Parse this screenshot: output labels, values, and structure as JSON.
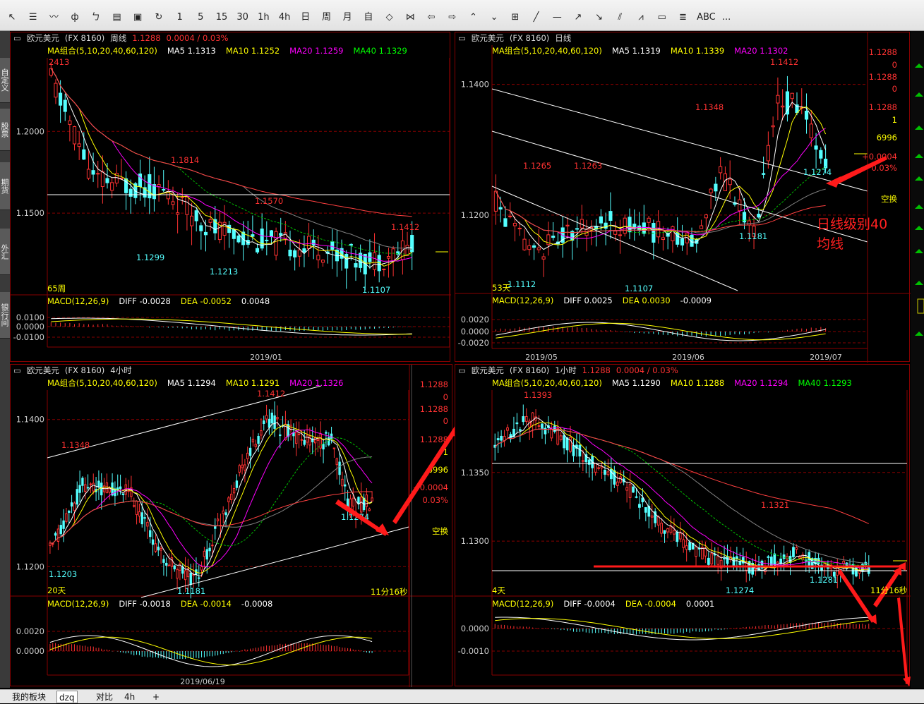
{
  "toolbar": {
    "items": [
      {
        "id": "arrow",
        "icon": "↖",
        "name": "cursor-icon"
      },
      {
        "id": "list",
        "icon": "☰",
        "name": "list-icon"
      },
      {
        "id": "line",
        "icon": "〰",
        "name": "line-chart-icon"
      },
      {
        "id": "kline",
        "icon": "ф",
        "name": "candlestick-icon"
      },
      {
        "id": "fenshi",
        "icon": "ㄅ",
        "name": "timeshare-icon"
      },
      {
        "id": "f10",
        "icon": "▤",
        "name": "f10-icon"
      },
      {
        "id": "save",
        "icon": "▣",
        "name": "save-icon"
      },
      {
        "id": "refresh",
        "icon": "↻",
        "name": "refresh-icon"
      },
      {
        "id": "p1",
        "label": "1"
      },
      {
        "id": "p5",
        "label": "5"
      },
      {
        "id": "p15",
        "label": "15"
      },
      {
        "id": "p30",
        "label": "30"
      },
      {
        "id": "p1h",
        "label": "1h"
      },
      {
        "id": "p4h",
        "label": "4h"
      },
      {
        "id": "day",
        "label": "日"
      },
      {
        "id": "week",
        "label": "周"
      },
      {
        "id": "month",
        "label": "月"
      },
      {
        "id": "custom",
        "label": "自"
      },
      {
        "id": "zoomin",
        "icon": "◇",
        "name": "zoom-in-icon"
      },
      {
        "id": "zoomout",
        "icon": "⋈",
        "name": "zoom-out-icon"
      },
      {
        "id": "left",
        "icon": "⇦",
        "name": "arrow-left-icon"
      },
      {
        "id": "right",
        "icon": "⇨",
        "name": "arrow-right-icon"
      },
      {
        "id": "up",
        "icon": "⌃",
        "name": "arrow-up-icon"
      },
      {
        "id": "down",
        "icon": "⌄",
        "name": "arrow-down-icon"
      },
      {
        "id": "layout",
        "icon": "⊞",
        "name": "layout-icon"
      },
      {
        "id": "draw1",
        "icon": "╱",
        "name": "draw-line-icon"
      },
      {
        "id": "draw2",
        "icon": "—",
        "name": "horizontal-line-icon"
      },
      {
        "id": "draw3",
        "icon": "↗",
        "name": "ray-icon"
      },
      {
        "id": "draw4",
        "icon": "↘",
        "name": "down-ray-icon"
      },
      {
        "id": "draw5",
        "icon": "⫽",
        "name": "parallel-line-icon"
      },
      {
        "id": "draw6",
        "icon": "⩘",
        "name": "wave-icon"
      },
      {
        "id": "draw7",
        "icon": "▭",
        "name": "rect-icon"
      },
      {
        "id": "draw8",
        "icon": "≣",
        "name": "fib-icon"
      },
      {
        "id": "abc",
        "label": "ABC"
      },
      {
        "id": "more",
        "label": "..."
      }
    ]
  },
  "leftbar": {
    "tabs": [
      "自定义",
      "股票",
      "期货",
      "外汇",
      "银行间"
    ]
  },
  "bottombar": {
    "tabs": [
      "我的板块",
      "dzq",
      "对比",
      "4h"
    ],
    "add": "+"
  },
  "panels": [
    {
      "id": "weekly",
      "title": {
        "symbol": "欧元美元",
        "code": "(FX 8160)",
        "period": "周线",
        "price": "1.1288",
        "change": "0.0004 / 0.03%"
      },
      "ma": {
        "label": "MA组合(5,10,20,40,60,120)",
        "ma5": "MA5 1.1313",
        "ma10": "MA10 1.1252",
        "ma20": "MA20 1.1259",
        "ma40": "MA40 1.1329"
      },
      "yticks": [
        "1.2000",
        "1.1500"
      ],
      "labels": [
        "2413",
        "1.1814",
        "1.1570",
        "1.1412",
        "1.1299",
        "1.1213",
        "1.1107",
        "65周"
      ],
      "macd": {
        "label": "MACD(12,26,9)",
        "diff": "DIFF -0.0028",
        "dea": "DEA -0.0052",
        "val": "0.0048"
      },
      "macd_ticks": [
        "0.0100",
        "0.0000",
        "-0.0100"
      ],
      "date": "2019/01"
    },
    {
      "id": "daily",
      "title": {
        "symbol": "欧元美元",
        "code": "(FX 8160)",
        "period": "日线"
      },
      "ma": {
        "label": "MA组合(5,10,20,40,60,120)",
        "ma5": "MA5 1.1319",
        "ma10": "MA10 1.1339",
        "ma20": "MA20 1.1302"
      },
      "yticks": [
        "1.1400",
        "1.1200"
      ],
      "labels": [
        "1.1412",
        "1.1348",
        "1.1265",
        "1.1263",
        "1.1274",
        "1.1181",
        "1.1112",
        "1.1107",
        "53天"
      ],
      "annotation": "日线级别40均线",
      "quote": [
        "1.1288",
        "0",
        "1.1288",
        "0",
        "1.1288",
        "1",
        "6996",
        "+0.0004",
        "0.03%",
        "空换"
      ],
      "macd": {
        "label": "MACD(12,26,9)",
        "diff": "DIFF 0.0025",
        "dea": "DEA 0.0030",
        "val": "-0.0009"
      },
      "macd_ticks": [
        "0.0020",
        "0.0000",
        "-0.0020"
      ],
      "dates": [
        "2019/05",
        "2019/06",
        "2019/07"
      ]
    },
    {
      "id": "h4",
      "title": {
        "symbol": "欧元美元",
        "code": "(FX 8160)",
        "period": "4小时"
      },
      "ma": {
        "label": "MA组合(5,10,20,40,60,120)",
        "ma5": "MA5 1.1294",
        "ma10": "MA10 1.1291",
        "ma20": "MA20 1.1326"
      },
      "yticks": [
        "1.1400",
        "1.1200"
      ],
      "labels": [
        "1.1412",
        "1.1348",
        "1.1274",
        "1.1203",
        "1.1181",
        "20天",
        "11分16秒"
      ],
      "quote": [
        "1.1288",
        "0",
        "1.1288",
        "0",
        "1.1288",
        "1",
        "6996",
        "+0.0004",
        "0.03%",
        "空换"
      ],
      "macd": {
        "label": "MACD(12,26,9)",
        "diff": "DIFF -0.0018",
        "dea": "DEA -0.0014",
        "val": "-0.0008"
      },
      "macd_ticks": [
        "0.0020",
        "0.0000"
      ],
      "date": "2019/06/19"
    },
    {
      "id": "h1",
      "title": {
        "symbol": "欧元美元",
        "code": "(FX 8160)",
        "period": "1小时",
        "price": "1.1288",
        "change": "0.0004 / 0.03%"
      },
      "ma": {
        "label": "MA组合(5,10,20,40,60,120)",
        "ma5": "MA5 1.1290",
        "ma10": "MA10 1.1288",
        "ma20": "MA20 1.1294",
        "ma40": "MA40 1.1293"
      },
      "yticks": [
        "1.1350",
        "1.1300"
      ],
      "labels": [
        "1.1393",
        "1.1321",
        "1.1281",
        "1.1274",
        "4天",
        "11分16秒"
      ],
      "macd": {
        "label": "MACD(12,26,9)",
        "diff": "DIFF -0.0004",
        "dea": "DEA -0.0004",
        "val": "0.0001"
      },
      "macd_ticks": [
        "0.0000",
        "-0.0010"
      ]
    }
  ],
  "colors": {
    "up": "#ff3232",
    "down": "#54ffff",
    "ma5": "#ffffff",
    "ma10": "#ffff00",
    "ma20": "#ff00ff",
    "ma40": "#00ff00",
    "ma60": "#808080",
    "ma120": "#ff4040",
    "arrow": "#ff1a1a"
  }
}
